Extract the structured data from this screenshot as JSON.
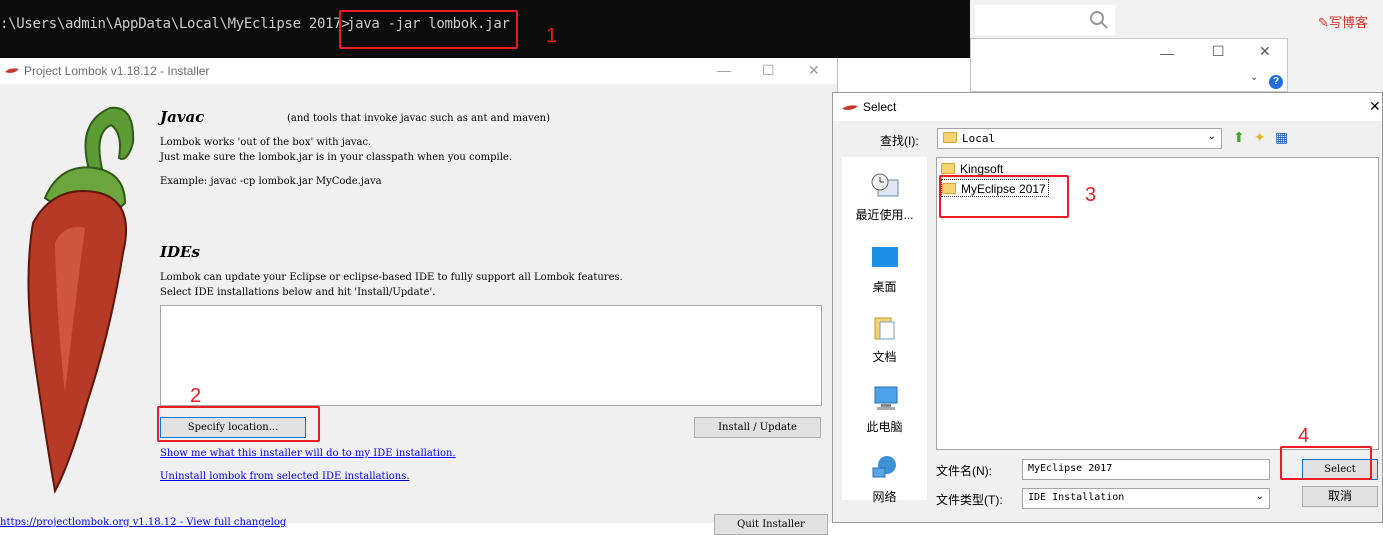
{
  "terminal": {
    "prompt": ":\\Users\\admin\\AppData\\Local\\MyEclipse 2017>",
    "command": "java -jar lombok.jar"
  },
  "browser_bg": {
    "blog_link": "写博客"
  },
  "lombok": {
    "title": "Project Lombok v1.18.12 - Installer",
    "javac_heading": "Javac",
    "javac_note": "(and tools that invoke javac such as ant and maven)",
    "javac_line1": "Lombok works 'out of the box' with javac.",
    "javac_line2": "Just make sure the lombok.jar is in your classpath when you compile.",
    "javac_example": "Example: javac -cp lombok.jar MyCode.java",
    "ides_heading": "IDEs",
    "ides_line1": "Lombok can update your Eclipse or eclipse-based IDE to fully support all Lombok features.",
    "ides_line2": "Select IDE installations below and hit 'Install/Update'.",
    "specify_button": "Specify location...",
    "install_button": "Install / Update",
    "link_show": "Show me what this installer will do to my IDE installation.",
    "link_uninstall": "Uninstall lombok from selected IDE installations.",
    "footer_partial": "https://projectlombok.org  v1.18.12 - View full changelog",
    "quit_button": "Quit Installer"
  },
  "select_dialog": {
    "title": "Select",
    "lookin_label": "查找(I):",
    "lookin_value": "Local",
    "places": [
      {
        "label": "最近使用...",
        "icon": "recent-icon"
      },
      {
        "label": "桌面",
        "icon": "desktop-icon"
      },
      {
        "label": "文档",
        "icon": "documents-icon"
      },
      {
        "label": "此电脑",
        "icon": "computer-icon"
      },
      {
        "label": "网络",
        "icon": "network-icon"
      }
    ],
    "files": [
      "Kingsoft",
      "MyEclipse 2017"
    ],
    "filename_label": "文件名(N):",
    "filename_value": "MyEclipse 2017",
    "filetype_label": "文件类型(T):",
    "filetype_value": "IDE Installation",
    "select_button": "Select",
    "cancel_button": "取消"
  },
  "annotations": [
    "1",
    "2",
    "3",
    "4"
  ],
  "colors": {
    "annotation_red": "#ec1c24",
    "link_blue": "#0000ee",
    "terminal_bg": "#0c0c0c"
  }
}
